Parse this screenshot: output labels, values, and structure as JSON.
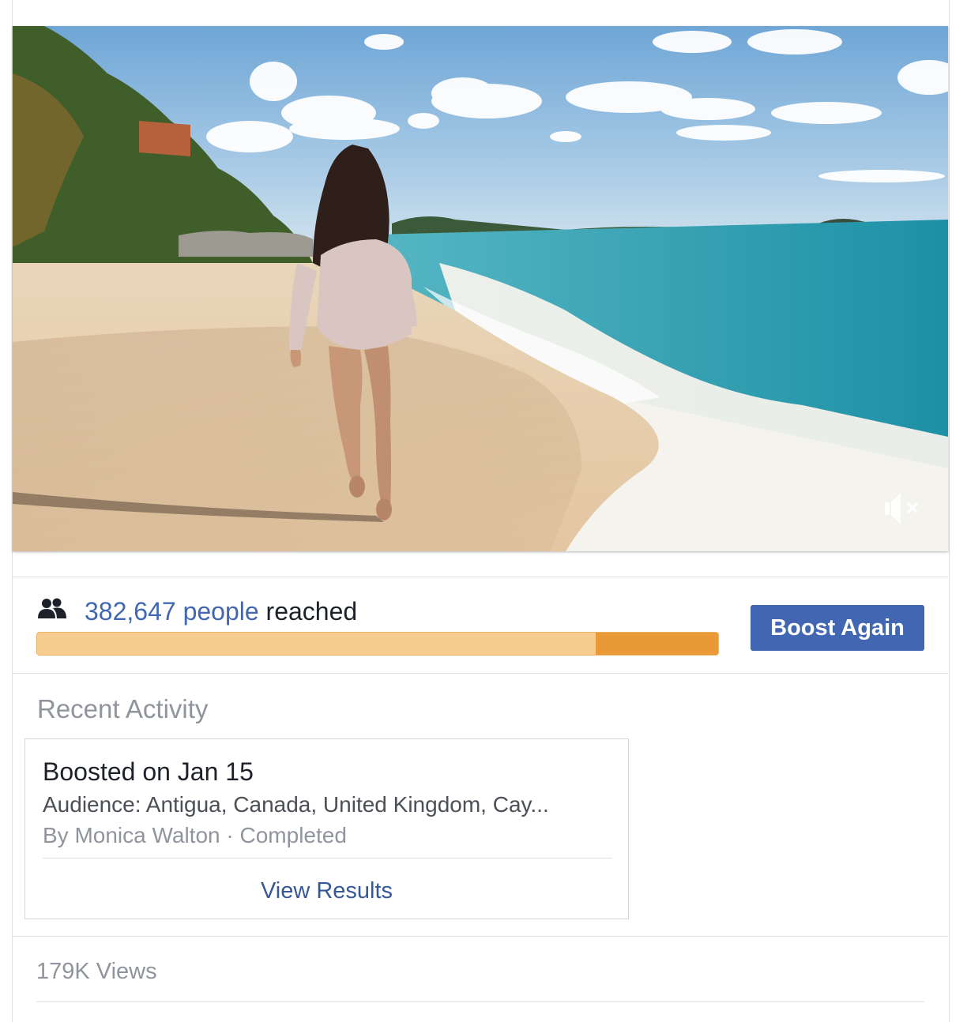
{
  "video": {
    "description_icon": "beach-video-thumbnail",
    "mute_icon": "volume-muted-icon"
  },
  "reach": {
    "icon": "people-icon",
    "count": "382,647 people",
    "suffix": " reached",
    "progress_fraction_paid": 0.82,
    "colors": {
      "organic": "#f7cc8f",
      "paid": "#e99a36",
      "link": "#4267b2"
    }
  },
  "boost_button": {
    "label": "Boost Again",
    "color": "#4267b2"
  },
  "recent_activity": {
    "title": "Recent Activity",
    "card": {
      "title": "Boosted on Jan 15",
      "audience": "Audience: Antigua, Canada, United Kingdom, Cay...",
      "author": "By Monica Walton",
      "separator": " · ",
      "status": "Completed",
      "link_label": "View Results"
    }
  },
  "stats": {
    "views": "179K Views"
  }
}
